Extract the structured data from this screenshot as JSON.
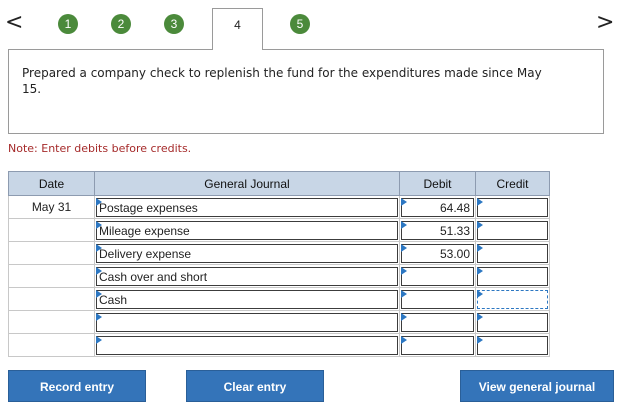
{
  "nav": {
    "prev_glyph": "<",
    "next_glyph": ">",
    "tabs": [
      "1",
      "2",
      "3",
      "4",
      "5"
    ],
    "active_tab": "4"
  },
  "instruction": "Prepared a company check to replenish the fund for the expenditures made since May 15.",
  "note": "Note: Enter debits before credits.",
  "table": {
    "headers": {
      "date": "Date",
      "journal": "General Journal",
      "debit": "Debit",
      "credit": "Credit"
    },
    "rows": [
      {
        "date": "May 31",
        "account": "Postage expenses",
        "debit": "64.48",
        "credit": ""
      },
      {
        "date": "",
        "account": "Mileage expense",
        "debit": "51.33",
        "credit": ""
      },
      {
        "date": "",
        "account": "Delivery expense",
        "debit": "53.00",
        "credit": ""
      },
      {
        "date": "",
        "account": "Cash over and short",
        "debit": "",
        "credit": ""
      },
      {
        "date": "",
        "account": "Cash",
        "debit": "",
        "credit": ""
      },
      {
        "date": "",
        "account": "",
        "debit": "",
        "credit": ""
      },
      {
        "date": "",
        "account": "",
        "debit": "",
        "credit": ""
      }
    ]
  },
  "buttons": {
    "record": "Record entry",
    "clear": "Clear entry",
    "view": "View general journal"
  },
  "colors": {
    "tab_green": "#4b8a3b",
    "button_blue": "#3474b9",
    "header_blue": "#c8d6e6",
    "note_red": "#a52a2a"
  }
}
